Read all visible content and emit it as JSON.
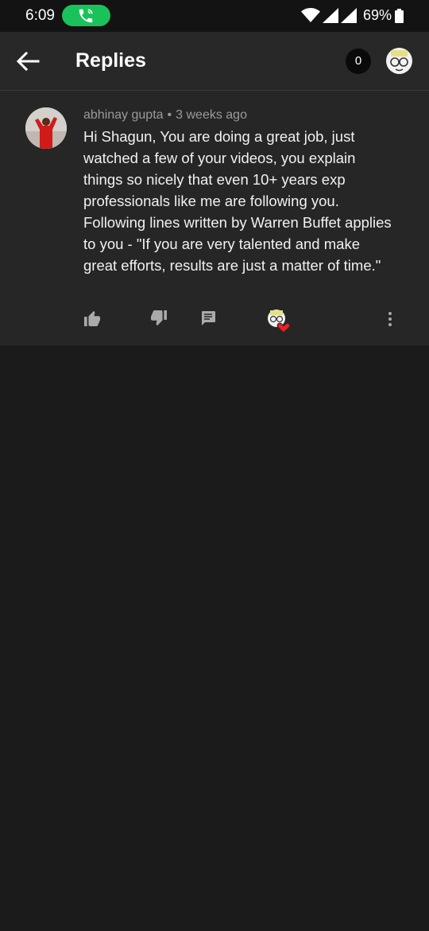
{
  "status_bar": {
    "time": "6:09",
    "battery": "69%",
    "icons": [
      "call-active-icon",
      "wifi-icon",
      "signal-icon",
      "signal-icon",
      "battery-icon"
    ],
    "call_color": "#19c25a"
  },
  "app_bar": {
    "title": "Replies",
    "count": "0",
    "icons": [
      "back-arrow-icon",
      "account-avatar"
    ]
  },
  "comment": {
    "author": "abhinay gupta",
    "separator": "•",
    "time_ago": "3 weeks ago",
    "text": "Hi Shagun, You are doing a great job, just watched a few of your videos, you explain things so nicely that even 10+ years exp professionals like me are following you. Following lines written by Warren Buffet applies to you - \"If you are very talented and make great efforts, results are just a matter of time.\"",
    "actions": [
      "thumb-up-icon",
      "thumb-down-icon",
      "reply-icon",
      "creator-heart-icon",
      "more-vert-icon"
    ],
    "heart_color": "#e8202a"
  },
  "colors": {
    "background": "#1b1b1b",
    "card": "#262626",
    "app_bar": "#282828",
    "meta_text": "#9a9a9a"
  }
}
